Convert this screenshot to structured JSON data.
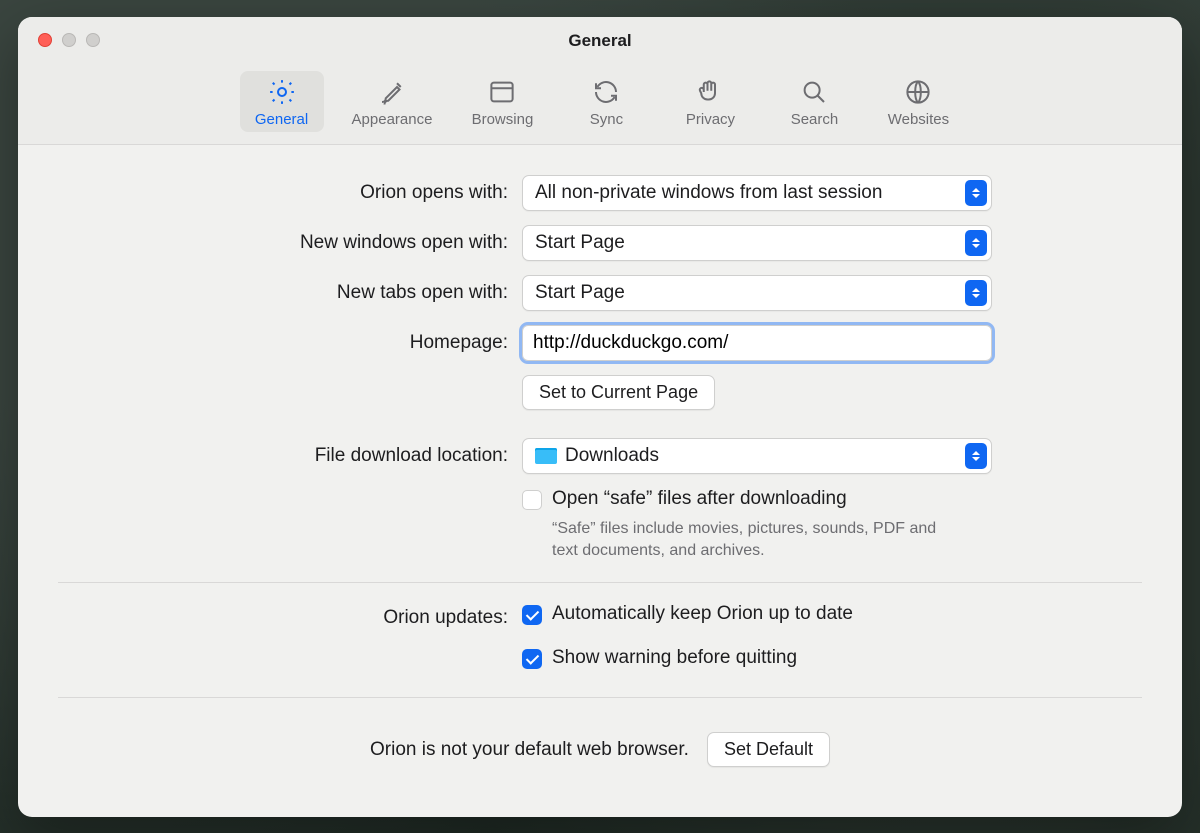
{
  "window": {
    "title": "General"
  },
  "toolbar": {
    "items": [
      {
        "label": "General"
      },
      {
        "label": "Appearance"
      },
      {
        "label": "Browsing"
      },
      {
        "label": "Sync"
      },
      {
        "label": "Privacy"
      },
      {
        "label": "Search"
      },
      {
        "label": "Websites"
      }
    ]
  },
  "labels": {
    "opens_with": "Orion opens with:",
    "new_windows": "New windows open with:",
    "new_tabs": "New tabs open with:",
    "homepage": "Homepage:",
    "set_current": "Set to Current Page",
    "download_location": "File download location:",
    "open_safe": "Open “safe” files after downloading",
    "safe_helper": "“Safe” files include movies, pictures, sounds, PDF and text documents, and archives.",
    "updates": "Orion updates:",
    "auto_update": "Automatically keep Orion up to date",
    "warn_quit": "Show warning before quitting",
    "default_status": "Orion is not your default web browser.",
    "set_default": "Set Default"
  },
  "values": {
    "opens_with": "All non-private windows from last session",
    "new_windows": "Start Page",
    "new_tabs": "Start Page",
    "homepage_url": "http://duckduckgo.com/",
    "download_location": "Downloads",
    "open_safe_checked": false,
    "auto_update_checked": true,
    "warn_quit_checked": true
  },
  "colors": {
    "accent": "#0f67f2"
  }
}
